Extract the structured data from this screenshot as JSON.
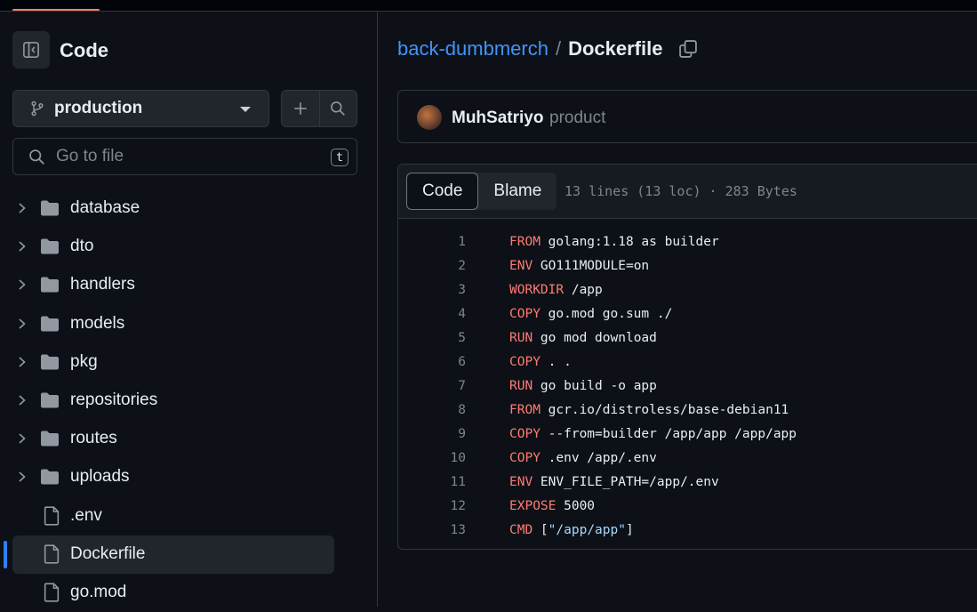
{
  "sidebar": {
    "title": "Code",
    "branch": "production",
    "search_placeholder": "Go to file",
    "search_shortcut": "t",
    "items": [
      {
        "type": "folder",
        "name": "database"
      },
      {
        "type": "folder",
        "name": "dto"
      },
      {
        "type": "folder",
        "name": "handlers"
      },
      {
        "type": "folder",
        "name": "models"
      },
      {
        "type": "folder",
        "name": "pkg"
      },
      {
        "type": "folder",
        "name": "repositories"
      },
      {
        "type": "folder",
        "name": "routes"
      },
      {
        "type": "folder",
        "name": "uploads"
      },
      {
        "type": "file",
        "name": ".env"
      },
      {
        "type": "file",
        "name": "Dockerfile",
        "selected": true
      },
      {
        "type": "file",
        "name": "go.mod"
      }
    ]
  },
  "breadcrumb": {
    "repo": "back-dumbmerch",
    "separator": "/",
    "file": "Dockerfile"
  },
  "commit": {
    "author": "MuhSatriyo",
    "message": "product"
  },
  "viewer": {
    "tab_code": "Code",
    "tab_blame": "Blame",
    "meta": "13 lines (13 loc) · 283 Bytes",
    "lines": [
      {
        "num": "1",
        "kw": "FROM",
        "rest": " golang:1.18 as builder"
      },
      {
        "num": "2",
        "kw": "ENV",
        "rest": " GO111MODULE=on"
      },
      {
        "num": "3",
        "kw": "WORKDIR",
        "rest": " /app"
      },
      {
        "num": "4",
        "kw": "COPY",
        "rest": " go.mod go.sum ./"
      },
      {
        "num": "5",
        "kw": "RUN",
        "rest": " go mod download"
      },
      {
        "num": "6",
        "kw": "COPY",
        "rest": " . ."
      },
      {
        "num": "7",
        "kw": "RUN",
        "rest": " go build -o app"
      },
      {
        "num": "8",
        "kw": "FROM",
        "rest": " gcr.io/distroless/base-debian11"
      },
      {
        "num": "9",
        "kw": "COPY",
        "rest": " --from=builder /app/app /app/app"
      },
      {
        "num": "10",
        "kw": "COPY",
        "rest": " .env /app/.env"
      },
      {
        "num": "11",
        "kw": "ENV",
        "rest": " ENV_FILE_PATH=/app/.env"
      },
      {
        "num": "12",
        "kw": "EXPOSE",
        "rest": " 5000"
      },
      {
        "num": "13",
        "kw": "CMD",
        "rest": " [",
        "str": "\"/app/app\"",
        "tail": "]"
      }
    ]
  },
  "colors": {
    "accent": "#f78166",
    "link": "#4493f8",
    "keyword": "#ff7b72",
    "string": "#a5d6ff",
    "selected_bar": "#2f81f7"
  }
}
